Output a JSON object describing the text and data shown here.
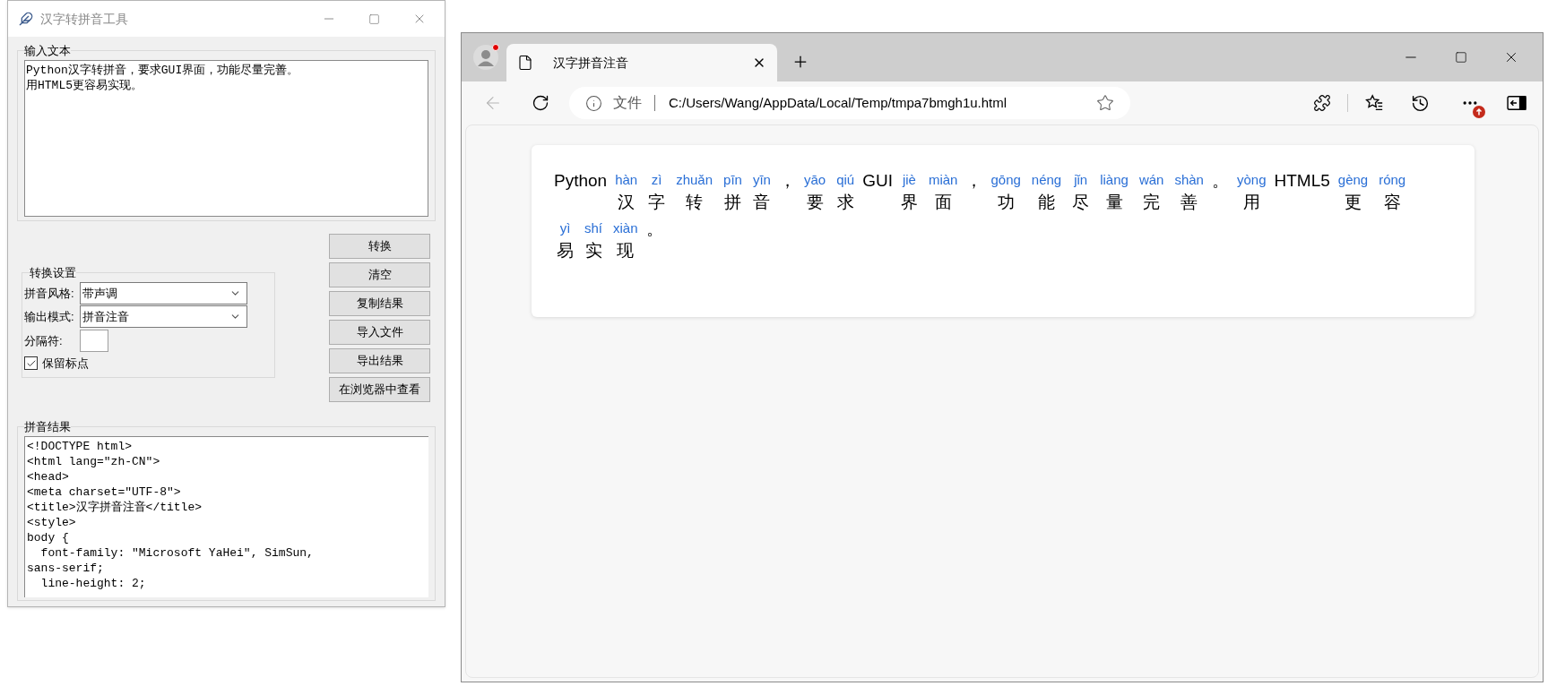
{
  "tool_window": {
    "title": "汉字转拼音工具",
    "input_label": "输入文本",
    "input_lines": [
      "Python汉字转拼音，要求GUI界面，功能尽量完善。",
      "用HTML5更容易实现。"
    ],
    "buttons": [
      "转换",
      "清空",
      "复制结果",
      "导入文件",
      "导出结果",
      "在浏览器中查看"
    ],
    "settings": {
      "label": "转换设置",
      "fields": [
        {
          "kind": "select",
          "label": "拼音风格:",
          "value": "带声调"
        },
        {
          "kind": "select",
          "label": "输出模式:",
          "value": "拼音注音"
        },
        {
          "kind": "entry",
          "label": "分隔符:"
        }
      ],
      "checkbox": {
        "label": "保留标点",
        "checked": true
      }
    },
    "result_label": "拼音结果",
    "result_lines": [
      "<!DOCTYPE html>",
      "<html lang=\"zh-CN\">",
      "<head>",
      "<meta charset=\"UTF-8\">",
      "<title>汉字拼音注音</title>",
      "<style>",
      "body {",
      "  font-family: \"Microsoft YaHei\", SimSun,",
      "sans-serif;",
      "  line-height: 2;"
    ]
  },
  "browser": {
    "tab": {
      "title": "汉字拼音注音"
    },
    "address": {
      "scheme": "文件",
      "url": "C:/Users/Wang/AppData/Local/Temp/tmpa7bmgh1u.html"
    },
    "page": {
      "lines": [
        [
          {
            "kind": "text",
            "text": "Python"
          },
          {
            "kind": "ruby",
            "pinyin": "hàn",
            "hanzi": "汉"
          },
          {
            "kind": "ruby",
            "pinyin": "zì",
            "hanzi": "字"
          },
          {
            "kind": "ruby",
            "pinyin": "zhuǎn",
            "hanzi": "转"
          },
          {
            "kind": "ruby",
            "pinyin": "pīn",
            "hanzi": "拼"
          },
          {
            "kind": "ruby",
            "pinyin": "yīn",
            "hanzi": "音"
          },
          {
            "kind": "text",
            "text": "，"
          },
          {
            "kind": "ruby",
            "pinyin": "yāo",
            "hanzi": "要"
          },
          {
            "kind": "ruby",
            "pinyin": "qiú",
            "hanzi": "求"
          },
          {
            "kind": "text",
            "text": "GUI"
          },
          {
            "kind": "ruby",
            "pinyin": "jiè",
            "hanzi": "界"
          },
          {
            "kind": "ruby",
            "pinyin": "miàn",
            "hanzi": "面"
          },
          {
            "kind": "text",
            "text": "，"
          },
          {
            "kind": "ruby",
            "pinyin": "gōng",
            "hanzi": "功"
          },
          {
            "kind": "ruby",
            "pinyin": "néng",
            "hanzi": "能"
          },
          {
            "kind": "ruby",
            "pinyin": "jǐn",
            "hanzi": "尽"
          },
          {
            "kind": "ruby",
            "pinyin": "liàng",
            "hanzi": "量"
          },
          {
            "kind": "ruby",
            "pinyin": "wán",
            "hanzi": "完"
          },
          {
            "kind": "ruby",
            "pinyin": "shàn",
            "hanzi": "善"
          },
          {
            "kind": "text",
            "text": "。"
          },
          {
            "kind": "ruby",
            "pinyin": "yòng",
            "hanzi": "用"
          },
          {
            "kind": "text",
            "text": "HTML5"
          },
          {
            "kind": "ruby",
            "pinyin": "gèng",
            "hanzi": "更"
          },
          {
            "kind": "ruby",
            "pinyin": "róng",
            "hanzi": "容"
          }
        ],
        [
          {
            "kind": "ruby",
            "pinyin": "yì",
            "hanzi": "易"
          },
          {
            "kind": "ruby",
            "pinyin": "shí",
            "hanzi": "实"
          },
          {
            "kind": "ruby",
            "pinyin": "xiàn",
            "hanzi": "现"
          },
          {
            "kind": "text",
            "text": "。"
          }
        ]
      ]
    }
  }
}
